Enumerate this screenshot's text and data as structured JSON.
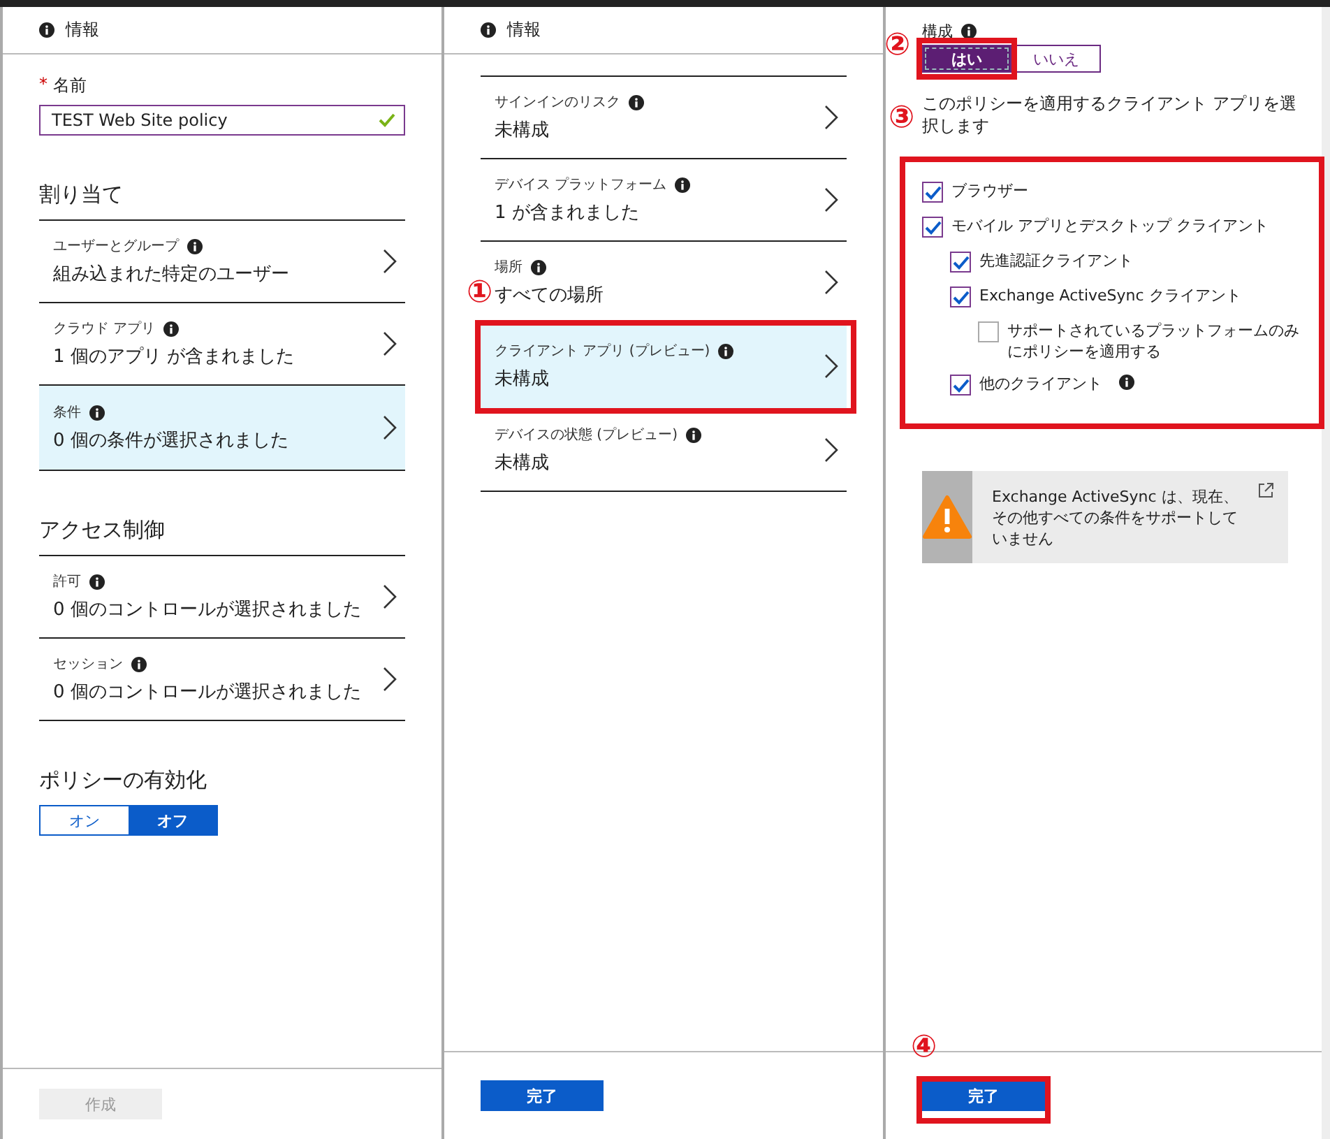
{
  "left": {
    "header": "情報",
    "name_field": {
      "label": "名前",
      "required_mark": "*",
      "value": "TEST Web Site policy",
      "valid": true
    },
    "sections": [
      {
        "title": "割り当て",
        "items": [
          {
            "label": "ユーザーとグループ",
            "value": "組み込まれた特定のユーザー",
            "selected": false
          },
          {
            "label": "クラウド アプリ",
            "value": "1 個のアプリ が含まれました",
            "selected": false
          },
          {
            "label": "条件",
            "value": "0 個の条件が選択されました",
            "selected": true
          }
        ]
      },
      {
        "title": "アクセス制御",
        "items": [
          {
            "label": "許可",
            "value": "0 個のコントロールが選択されました",
            "selected": false
          },
          {
            "label": "セッション",
            "value": "0 個のコントロールが選択されました",
            "selected": false
          }
        ]
      }
    ],
    "enable": {
      "title": "ポリシーの有効化",
      "options": [
        {
          "label": "オン",
          "selected": false
        },
        {
          "label": "オフ",
          "selected": true
        }
      ]
    },
    "footer_button": {
      "label": "作成",
      "disabled": true
    }
  },
  "middle": {
    "header": "情報",
    "items": [
      {
        "label": "サインインのリスク",
        "value": "未構成",
        "selected": false
      },
      {
        "label": "デバイス プラットフォーム",
        "value": "1 が含まれました",
        "selected": false
      },
      {
        "label": "場所",
        "value": "すべての場所",
        "selected": false
      },
      {
        "label": "クライアント アプリ (プレビュー)",
        "value": "未構成",
        "selected": true,
        "callout": "①"
      },
      {
        "label": "デバイスの状態 (プレビュー)",
        "value": "未構成",
        "selected": false
      }
    ],
    "footer_button": {
      "label": "完了",
      "disabled": false
    }
  },
  "right": {
    "configure": {
      "label": "構成",
      "callout": "②",
      "options": [
        {
          "label": "はい",
          "selected": true
        },
        {
          "label": "いいえ",
          "selected": false
        }
      ]
    },
    "prompt": {
      "text": "このポリシーを適用するクライアント アプリを選択します",
      "callout": "③"
    },
    "client_apps": [
      {
        "label": "ブラウザー",
        "checked": true
      },
      {
        "label": "モバイル アプリとデスクトップ クライアント",
        "checked": true,
        "children": [
          {
            "label": "先進認証クライアント",
            "checked": true
          },
          {
            "label": "Exchange ActiveSync クライアント",
            "checked": true,
            "children": [
              {
                "label": "サポートされているプラットフォームのみにポリシーを適用する",
                "checked": false
              }
            ]
          },
          {
            "label": "他のクライアント",
            "checked": true,
            "info": true
          }
        ]
      }
    ],
    "warning": "Exchange ActiveSync は、現在、その他すべての条件をサポートしていません",
    "footer_button": {
      "label": "完了",
      "disabled": false,
      "callout": "④"
    }
  }
}
